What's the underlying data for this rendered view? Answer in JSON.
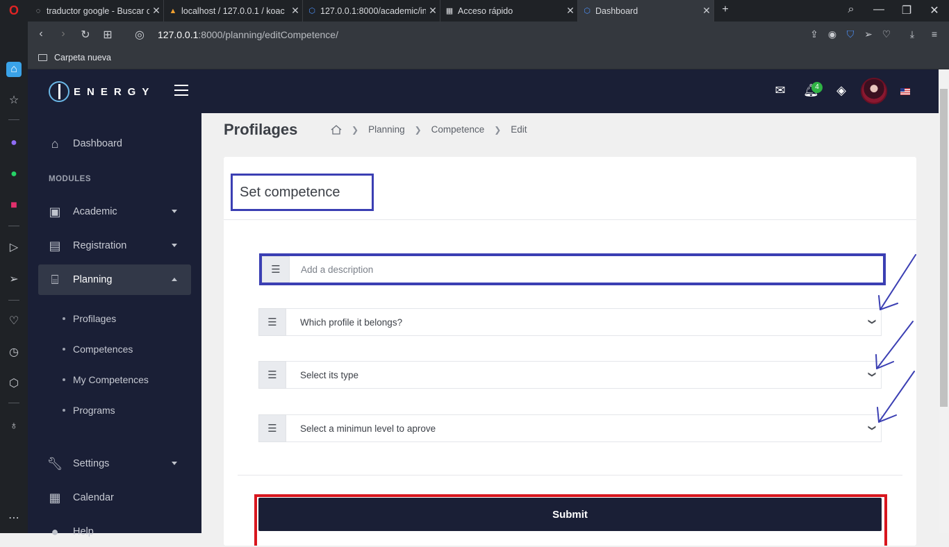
{
  "browser": {
    "tabs": [
      {
        "title": "traductor google - Buscar c",
        "icon": "opera-search-icon"
      },
      {
        "title": "localhost / 127.0.0.1 / koac",
        "icon": "phpmyadmin-icon"
      },
      {
        "title": "127.0.0.1:8000/academic/in",
        "icon": "app-hex-icon"
      },
      {
        "title": "Acceso rápido",
        "icon": "grid-icon"
      },
      {
        "title": "Dashboard",
        "icon": "app-hex-icon"
      }
    ],
    "new_tab": "+",
    "url_host": "127.0.0.1",
    "url_rest": ":8000/planning/editCompetence/",
    "bookmark_folder": "Carpeta nueva"
  },
  "header": {
    "logo_text": "ENERGY",
    "notification_count": "4",
    "colors": {
      "navy": "#1a1f36",
      "badge_green": "#2fb344"
    }
  },
  "sidebar": {
    "dashboard": "Dashboard",
    "modules_label": "MODULES",
    "items": [
      {
        "label": "Academic",
        "icon": "academic-icon"
      },
      {
        "label": "Registration",
        "icon": "id-card-icon"
      },
      {
        "label": "Planning",
        "icon": "bank-icon"
      }
    ],
    "planning_sub": [
      "Profilages",
      "Competences",
      "My Competences",
      "Programs"
    ],
    "settings": "Settings",
    "calendar": "Calendar",
    "help": "Help"
  },
  "main": {
    "page_title": "Profilages",
    "breadcrumb": [
      "Planning",
      "Competence",
      "Edit"
    ],
    "card_title": "Set competence",
    "description_placeholder": "Add a description",
    "profile_select": "Which profile it belongs?",
    "type_select": "Select its type",
    "level_select": "Select a minimun level to aprove",
    "submit_label": "Submit",
    "annotation_colors": {
      "highlight_blue": "#3b3fb3",
      "highlight_red": "#d8161e"
    }
  }
}
